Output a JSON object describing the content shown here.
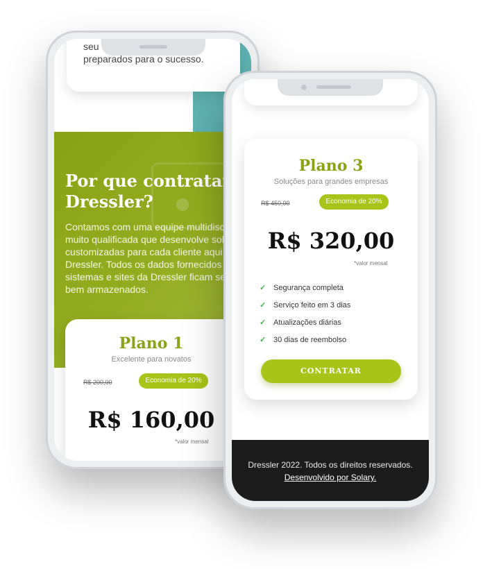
{
  "phone_left": {
    "top_card_text": "seus ... preparados para o sucesso.",
    "top_card_line1": "seu",
    "top_card_line2": "preparados para o sucesso.",
    "why_title_line1": "Por que contratar",
    "why_title_line2": "Dressler?",
    "why_body": "Contamos com uma equipe multidisciplinar muito qualificada que desenvolve soluções customizadas para cada cliente aqui na Dressler. Todos os dados fornecidos nos sistemas e sites da Dressler ficam seguros e bem armazenados.",
    "plan": {
      "title": "Plano 1",
      "subtitle": "Excelente para novatos",
      "old_price": "R$ 200,00",
      "badge": "Economia de 20%",
      "price": "R$ 160,00",
      "price_note": "*valor mensal"
    }
  },
  "phone_right": {
    "plan": {
      "title": "Plano 3",
      "subtitle": "Soluções para grandes empresas",
      "old_price": "R$ 450,00",
      "badge": "Economia de 20%",
      "price": "R$ 320,00",
      "price_note": "*valor mensal",
      "features": [
        "Segurança completa",
        "Serviço feito em 3 dias",
        "Atualizações diárias",
        "30 dias de reembolso"
      ],
      "cta": "CONTRATAR"
    },
    "footer": {
      "text": "Dressler 2022. Todos os direitos reservados.",
      "link": "Desenvolvido por Solary."
    }
  },
  "colors": {
    "accent": "#a8c418",
    "olive": "#8aa316",
    "teal": "#5fb3b3",
    "footer_bg": "#1c1c1c",
    "check": "#3bb54a"
  },
  "icons": [
    "check-icon"
  ]
}
